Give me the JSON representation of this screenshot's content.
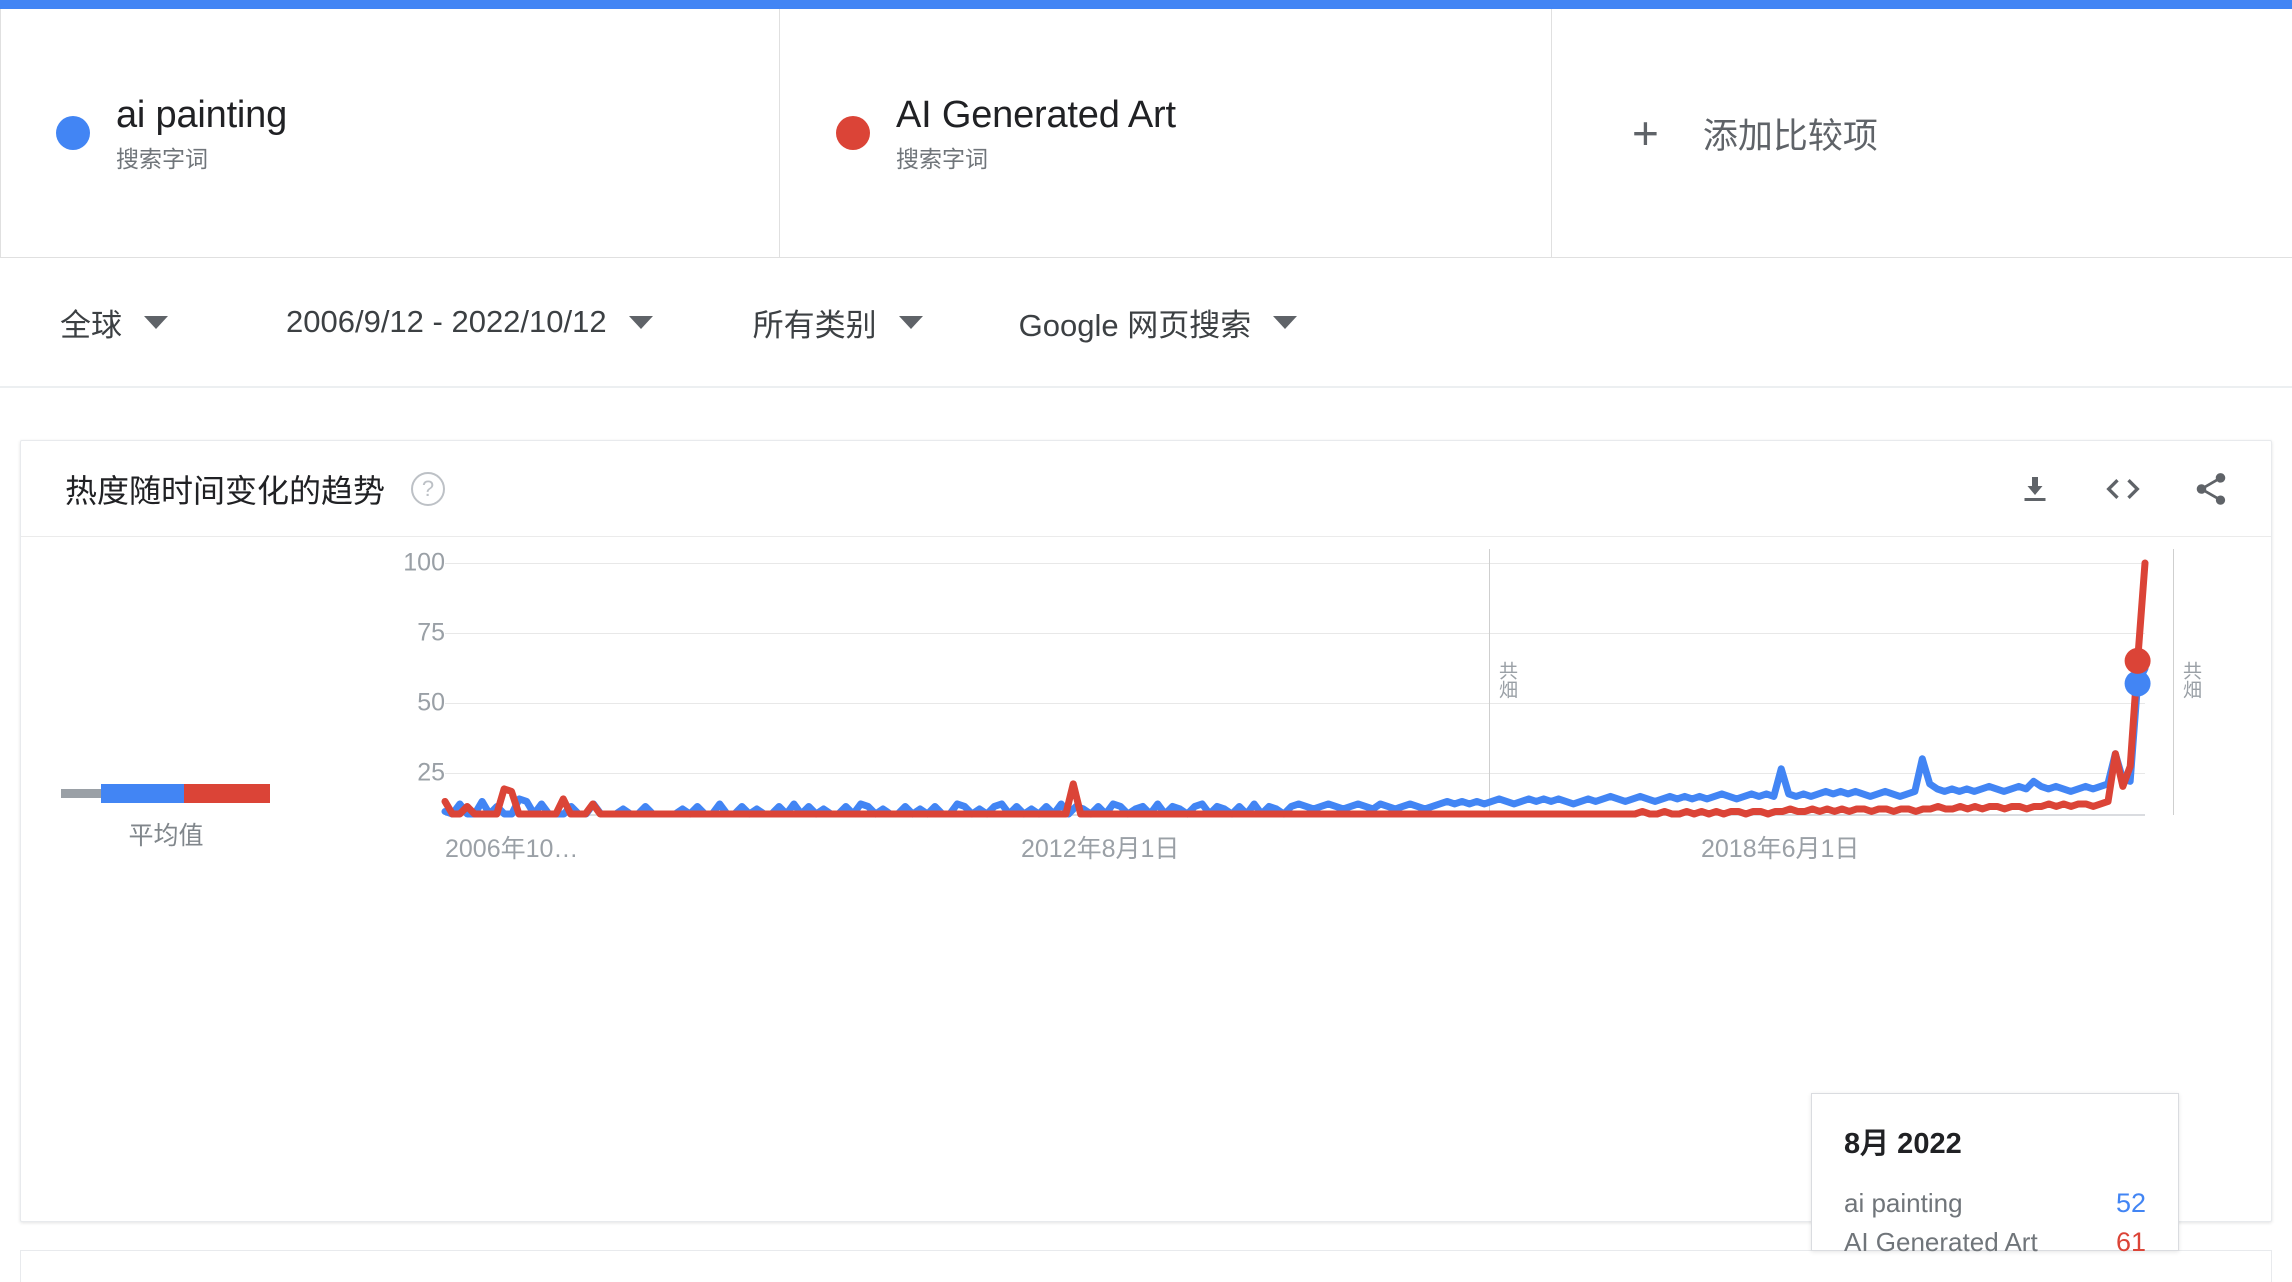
{
  "top_bar": {
    "color": "#4285f4"
  },
  "comparison": {
    "terms": [
      {
        "name": "ai painting",
        "type_label": "搜索字词",
        "color": "#4285f4",
        "dot": "blue-dot"
      },
      {
        "name": "AI Generated Art",
        "type_label": "搜索字词",
        "color": "#db4437",
        "dot": "red-dot"
      }
    ],
    "add_button": {
      "plus": "+",
      "label": "添加比较项"
    }
  },
  "filters": [
    {
      "label": "全球",
      "icon": "chevron-down-icon"
    },
    {
      "label": "2006/9/12 - 2022/10/12",
      "icon": "chevron-down-icon"
    },
    {
      "label": "所有类别",
      "icon": "chevron-down-icon"
    },
    {
      "label": "Google 网页搜索",
      "icon": "chevron-down-icon"
    }
  ],
  "chart_card": {
    "title": "热度随时间变化的趋势",
    "help_icon": "?",
    "tools": [
      {
        "name": "download-icon",
        "label": "下载"
      },
      {
        "name": "embed-code-icon",
        "label": "嵌入"
      },
      {
        "name": "share-icon",
        "label": "分享"
      }
    ],
    "average_legend": {
      "label": "平均值"
    },
    "annotations": [
      {
        "text": "共畑"
      },
      {
        "text": "共畑"
      }
    ]
  },
  "tooltip": {
    "date": "8月 2022",
    "rows": [
      {
        "name": "ai painting",
        "value": "52",
        "color": "#4285f4"
      },
      {
        "name": "AI Generated Art",
        "value": "61",
        "color": "#db4437"
      }
    ]
  },
  "chart_data": {
    "type": "line",
    "title": "热度随时间变化的趋势",
    "xlabel": "",
    "ylabel": "",
    "ylim": [
      0,
      100
    ],
    "yticks": [
      100,
      75,
      50,
      25
    ],
    "grid": true,
    "legend_position": "top",
    "xticks": [
      "2006年10…",
      "2012年8月1日",
      "2018年6月1日"
    ],
    "x_start": "2006-10",
    "x_end": "2022-10",
    "highlight_point": {
      "x_label": "8月 2022",
      "values": {
        "ai painting": 52,
        "AI Generated Art": 61
      }
    },
    "series": [
      {
        "name": "ai painting",
        "color": "#4285f4",
        "values": [
          1,
          0,
          4,
          0,
          0,
          5,
          0,
          3,
          0,
          0,
          6,
          5,
          0,
          4,
          0,
          0,
          0,
          3,
          0,
          0,
          4,
          0,
          0,
          0,
          2,
          0,
          0,
          3,
          0,
          0,
          0,
          0,
          2,
          0,
          3,
          0,
          0,
          4,
          0,
          0,
          3,
          0,
          2,
          0,
          0,
          3,
          0,
          4,
          0,
          3,
          0,
          2,
          0,
          0,
          3,
          0,
          4,
          3,
          0,
          2,
          0,
          0,
          3,
          0,
          2,
          0,
          3,
          0,
          0,
          4,
          3,
          0,
          2,
          0,
          3,
          4,
          0,
          3,
          0,
          2,
          0,
          3,
          0,
          4,
          0,
          3,
          2,
          0,
          3,
          0,
          4,
          3,
          0,
          2,
          3,
          0,
          4,
          0,
          3,
          2,
          0,
          3,
          4,
          0,
          3,
          2,
          0,
          3,
          0,
          4,
          0,
          3,
          2,
          0,
          3,
          4,
          3,
          2,
          3,
          4,
          3,
          2,
          3,
          4,
          3,
          2,
          4,
          3,
          2,
          3,
          4,
          3,
          2,
          3,
          4,
          5,
          4,
          5,
          4,
          5,
          4,
          5,
          6,
          5,
          4,
          5,
          6,
          5,
          6,
          5,
          6,
          5,
          4,
          5,
          6,
          5,
          6,
          7,
          6,
          5,
          6,
          7,
          6,
          5,
          6,
          7,
          6,
          7,
          6,
          7,
          6,
          7,
          8,
          7,
          6,
          7,
          8,
          7,
          8,
          7,
          18,
          8,
          7,
          8,
          7,
          8,
          9,
          8,
          9,
          8,
          9,
          8,
          7,
          8,
          9,
          8,
          7,
          8,
          9,
          22,
          12,
          10,
          9,
          10,
          9,
          10,
          9,
          10,
          11,
          10,
          9,
          10,
          11,
          10,
          13,
          11,
          10,
          11,
          10,
          9,
          10,
          11,
          10,
          11,
          12,
          24,
          14,
          13,
          52,
          58
        ]
      },
      {
        "name": "AI Generated Art",
        "color": "#db4437",
        "values": [
          5,
          0,
          0,
          3,
          0,
          0,
          0,
          0,
          10,
          9,
          0,
          0,
          0,
          0,
          0,
          0,
          6,
          0,
          0,
          0,
          4,
          0,
          0,
          0,
          0,
          0,
          0,
          0,
          0,
          0,
          0,
          0,
          0,
          0,
          0,
          0,
          0,
          0,
          0,
          0,
          0,
          0,
          0,
          0,
          0,
          0,
          0,
          0,
          0,
          0,
          0,
          0,
          0,
          0,
          0,
          0,
          0,
          0,
          0,
          0,
          0,
          0,
          0,
          0,
          0,
          0,
          0,
          0,
          0,
          0,
          0,
          0,
          0,
          0,
          0,
          0,
          0,
          0,
          0,
          0,
          0,
          0,
          0,
          0,
          0,
          12,
          0,
          0,
          0,
          0,
          0,
          0,
          0,
          0,
          0,
          0,
          0,
          0,
          0,
          0,
          0,
          0,
          0,
          0,
          0,
          0,
          0,
          0,
          0,
          0,
          0,
          0,
          0,
          0,
          0,
          0,
          0,
          0,
          0,
          0,
          0,
          0,
          0,
          0,
          0,
          0,
          0,
          0,
          0,
          0,
          0,
          0,
          0,
          0,
          0,
          0,
          0,
          0,
          0,
          0,
          0,
          0,
          0,
          0,
          0,
          0,
          0,
          0,
          0,
          0,
          0,
          0,
          0,
          0,
          0,
          0,
          0,
          0,
          0,
          0,
          0,
          0,
          1,
          0,
          0,
          1,
          0,
          0,
          1,
          0,
          1,
          0,
          1,
          0,
          1,
          1,
          0,
          1,
          1,
          0,
          1,
          1,
          2,
          1,
          1,
          2,
          1,
          2,
          1,
          2,
          1,
          2,
          2,
          1,
          2,
          2,
          1,
          2,
          2,
          1,
          2,
          2,
          3,
          2,
          2,
          3,
          2,
          3,
          2,
          3,
          3,
          2,
          3,
          3,
          2,
          3,
          3,
          4,
          3,
          4,
          3,
          4,
          4,
          3,
          4,
          5,
          24,
          11,
          19,
          61,
          100
        ]
      }
    ]
  }
}
